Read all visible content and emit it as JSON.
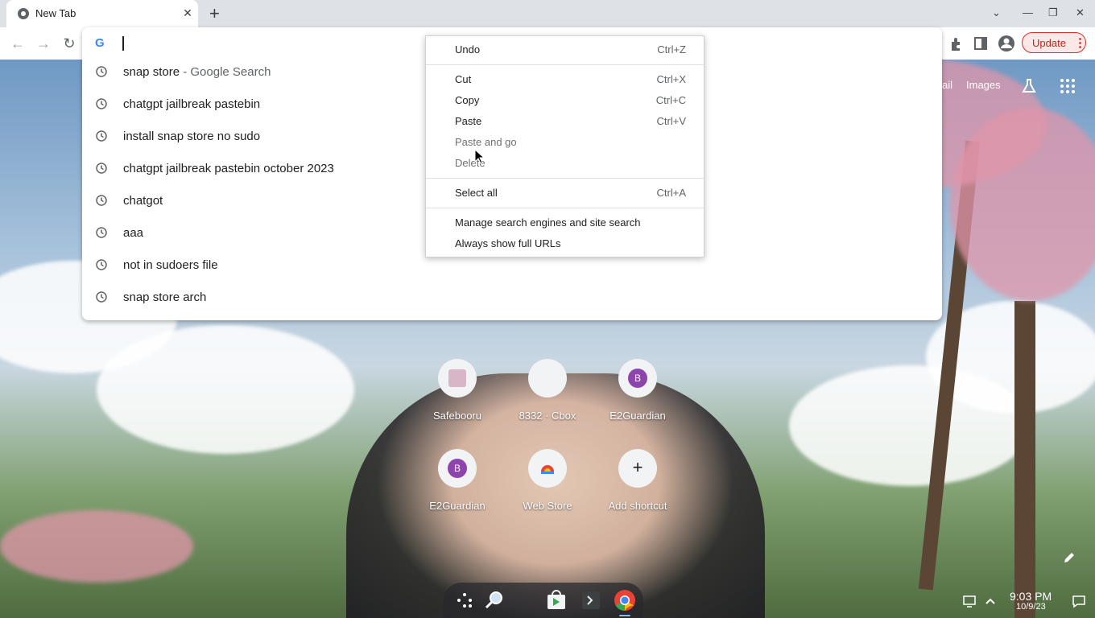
{
  "tab": {
    "title": "New Tab",
    "close_icon": "close-icon"
  },
  "toolbar": {
    "update_label": "Update"
  },
  "omnibox": {
    "value": "",
    "suggestions": [
      {
        "text": "snap store",
        "sub": " - Google Search"
      },
      {
        "text": "chatgpt jailbreak pastebin",
        "sub": ""
      },
      {
        "text": "install snap store no sudo",
        "sub": ""
      },
      {
        "text": "chatgpt jailbreak pastebin october 2023",
        "sub": ""
      },
      {
        "text": "chatgot",
        "sub": ""
      },
      {
        "text": "aaa",
        "sub": ""
      },
      {
        "text": "not in sudoers file",
        "sub": ""
      },
      {
        "text": "snap store arch",
        "sub": ""
      }
    ]
  },
  "context_menu": {
    "undo": {
      "label": "Undo",
      "shortcut": "Ctrl+Z"
    },
    "cut": {
      "label": "Cut",
      "shortcut": "Ctrl+X"
    },
    "copy": {
      "label": "Copy",
      "shortcut": "Ctrl+C"
    },
    "paste": {
      "label": "Paste",
      "shortcut": "Ctrl+V"
    },
    "paste_and_go": {
      "label": "Paste and go"
    },
    "delete": {
      "label": "Delete"
    },
    "select_all": {
      "label": "Select all",
      "shortcut": "Ctrl+A"
    },
    "manage_search": {
      "label": "Manage search engines and site search"
    },
    "always_full_urls": {
      "label": "Always show full URLs"
    }
  },
  "ntp": {
    "gmail_partial": "ail",
    "images": "Images",
    "shortcuts": [
      {
        "label": "Safebooru",
        "letter": ""
      },
      {
        "label": "8332 · Cbox",
        "letter": ""
      },
      {
        "label": "E2Guardian",
        "letter": "B"
      },
      {
        "label": "E2Guardian",
        "letter": "B"
      },
      {
        "label": "Web Store",
        "letter": ""
      },
      {
        "label": "Add shortcut",
        "letter": "+"
      }
    ]
  },
  "shelf": {
    "time": "9:03 PM",
    "date": "10/9/23"
  },
  "colors": {
    "update_accent": "#d93025",
    "tab_strip": "#dee1e6",
    "shortcut_letter_bg": "#8e44ad"
  }
}
